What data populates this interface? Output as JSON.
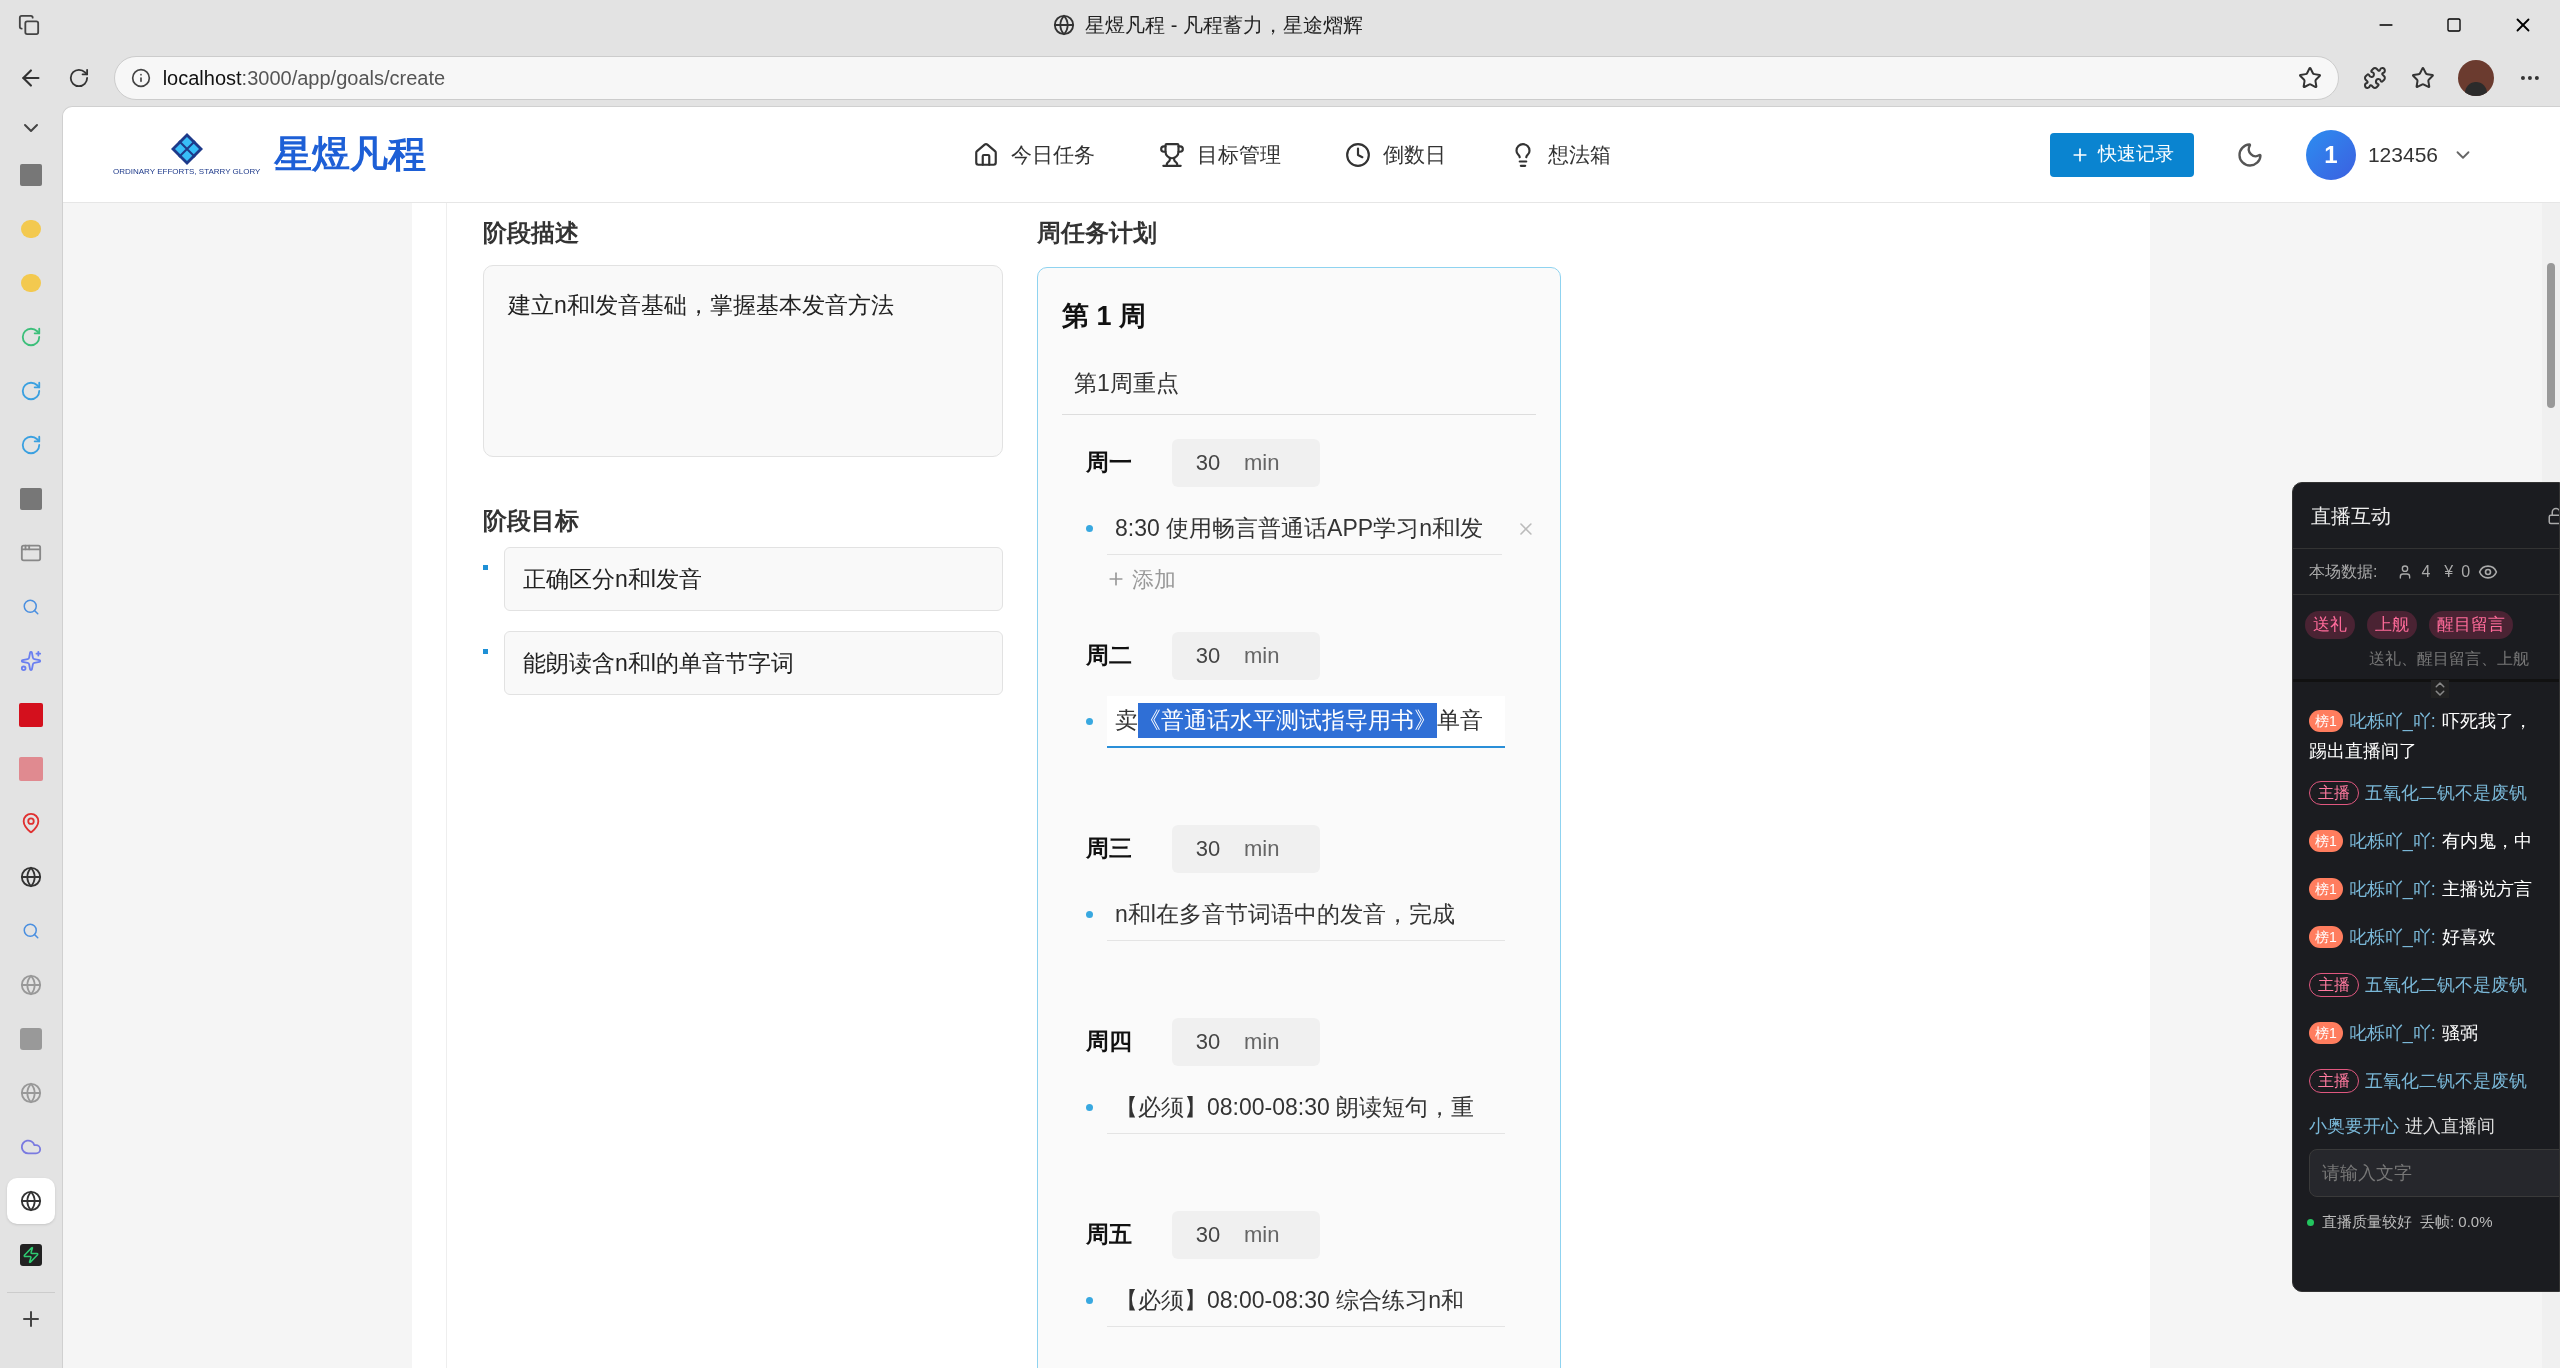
{
  "browser": {
    "title": "星煜凡程 - 凡程蓄力，星途熠辉",
    "url_host": "localhost",
    "url_path": ":3000/app/goals/create"
  },
  "vertical_tabs": [
    {
      "kind": "mimo",
      "selected": false
    },
    {
      "kind": "bear",
      "selected": false
    },
    {
      "kind": "bear",
      "selected": false
    },
    {
      "kind": "swirl-green",
      "selected": false
    },
    {
      "kind": "swirl-blue",
      "selected": false
    },
    {
      "kind": "swirl-blue",
      "selected": false
    },
    {
      "kind": "mimo",
      "selected": false
    },
    {
      "kind": "window",
      "selected": false
    },
    {
      "kind": "search",
      "selected": false
    },
    {
      "kind": "sparkle",
      "selected": false
    },
    {
      "kind": "jd",
      "selected": false
    },
    {
      "kind": "jd-faded",
      "selected": false
    },
    {
      "kind": "pin",
      "selected": false
    },
    {
      "kind": "globe",
      "selected": false
    },
    {
      "kind": "search",
      "selected": false
    },
    {
      "kind": "globe-faded",
      "selected": false
    },
    {
      "kind": "z",
      "selected": false
    },
    {
      "kind": "globe-faded",
      "selected": false
    },
    {
      "kind": "cloud",
      "selected": false
    },
    {
      "kind": "globe",
      "selected": true
    },
    {
      "kind": "bolt",
      "selected": false
    }
  ],
  "header": {
    "logo_text": "星煜凡程",
    "logo_tagline": "ORDINARY EFFORTS, STARRY GLORY",
    "nav": [
      {
        "kind": "home",
        "label": "今日任务",
        "selected": false
      },
      {
        "kind": "trophy",
        "label": "目标管理",
        "selected": false
      },
      {
        "kind": "clock",
        "label": "倒数日",
        "selected": false
      },
      {
        "kind": "bulb",
        "label": "想法箱",
        "selected": false
      }
    ],
    "quick_button": "快速记录",
    "avatar_text": "1",
    "username": "123456"
  },
  "stage": {
    "description_label": "阶段描述",
    "description": "建立n和l发音基础，掌握基本发音方法",
    "goals_label": "阶段目标",
    "goals": [
      "正确区分n和l发音",
      "能朗读含n和l的单音节字词"
    ]
  },
  "weekly": {
    "label": "周任务计划",
    "week_title": "第 1 周",
    "focus": "第1周重点",
    "days": [
      {
        "name": "周一",
        "minutes": "30",
        "unit": "min",
        "tasks": [
          {
            "before": "8:30 使用畅言普通话APP学习n和l发",
            "focused": false,
            "removable": true
          }
        ],
        "add_label": "添加"
      },
      {
        "name": "周二",
        "minutes": "30",
        "unit": "min",
        "tasks": [
          {
            "before": "卖",
            "selected_text": "《普通话水平测试指导用书》",
            "after": "单音",
            "focused": true,
            "removable": false
          }
        ]
      },
      {
        "name": "周三",
        "minutes": "30",
        "unit": "min",
        "tasks": [
          {
            "before": "n和l在多音节词语中的发音，完成",
            "focused": false,
            "removable": false
          }
        ]
      },
      {
        "name": "周四",
        "minutes": "30",
        "unit": "min",
        "tasks": [
          {
            "before": "【必须】08:00-08:30 朗读短句，重",
            "focused": false,
            "removable": false
          }
        ]
      },
      {
        "name": "周五",
        "minutes": "30",
        "unit": "min",
        "tasks": [
          {
            "before": "【必须】08:00-08:30 综合练习n和",
            "focused": false,
            "removable": false
          }
        ]
      }
    ]
  },
  "live_panel": {
    "title": "直播互动",
    "stats_label": "本场数据:",
    "viewers": "4",
    "currency": "¥",
    "money": "0",
    "tags": [
      "送礼",
      "上舰",
      "醒目留言"
    ],
    "filter_hint": "送礼、醒目留言、上舰",
    "messages": [
      {
        "badge": "榜1",
        "kind": "rank",
        "user": "叱栎吖_吖:",
        "text": "吓死我了，",
        "text_line2": "踢出直播间了"
      },
      {
        "badge": "主播",
        "kind": "host",
        "user": "五氧化二钒不是废钒"
      },
      {
        "badge": "榜1",
        "kind": "rank",
        "user": "叱栎吖_吖:",
        "text": "有内鬼，中"
      },
      {
        "badge": "榜1",
        "kind": "rank",
        "user": "叱栎吖_吖:",
        "text": "主播说方言"
      },
      {
        "badge": "榜1",
        "kind": "rank",
        "user": "叱栎吖_吖:",
        "text": "好喜欢"
      },
      {
        "badge": "主播",
        "kind": "host",
        "user": "五氧化二钒不是废钒"
      },
      {
        "badge": "榜1",
        "kind": "rank",
        "user": "叱栎吖_吖:",
        "text": "骚弼"
      },
      {
        "badge": "主播",
        "kind": "host",
        "user": "五氧化二钒不是废钒"
      }
    ],
    "enter_user": "小奥要开心",
    "enter_text": "进入直播间",
    "input_placeholder": "请输入文字",
    "quality": "直播质量较好",
    "frame_drop": "丢帧: 0.0%"
  }
}
